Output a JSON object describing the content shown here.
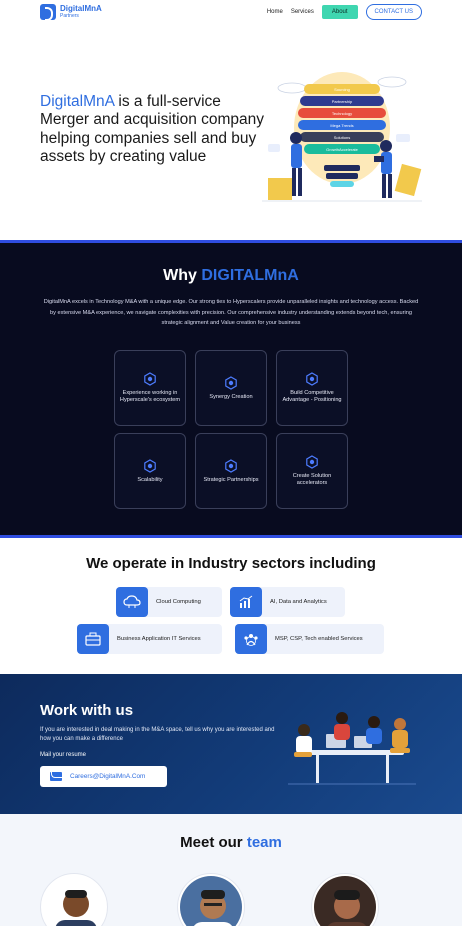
{
  "header": {
    "logo_name": "DigitalMnA",
    "logo_sub": "Partners",
    "nav": {
      "home": "Home",
      "services": "Services",
      "about": "About",
      "contact": "CONTACT US"
    }
  },
  "hero": {
    "brand": "DigitalMnA",
    "text": " is a full-service Merger and acquisition company helping companies sell and buy assets by creating value",
    "illustration_layers": [
      "Sourcing",
      "Partnership",
      "Technology",
      "Mega Trends",
      "Solutions",
      "GrowthAccelerate"
    ]
  },
  "why": {
    "title_prefix": "Why ",
    "title_accent": "DIGITALMnA",
    "description": "DigitalMnA excels in Technology M&A with a unique edge. Our strong ties to Hyperscalers provide unparalleled insights and technology access. Backed by extensive M&A experience, we navigate complexities with precision. Our comprehensive industry understanding extends beyond tech, ensuring strategic alignment and Value creation for your business",
    "cards": [
      {
        "label": "Experience working in Hyperscale's ecosystem",
        "icon": "hexagon-gear-icon"
      },
      {
        "label": "Synergy Creation",
        "icon": "hexagon-gear-icon"
      },
      {
        "label": "Build Competitive Advantage - Positioning",
        "icon": "hexagon-gear-icon"
      },
      {
        "label": "Scalability",
        "icon": "hexagon-gear-icon"
      },
      {
        "label": "Strategic Partnerships",
        "icon": "hexagon-gear-icon"
      },
      {
        "label": "Create Solution accelerators",
        "icon": "hexagon-gear-icon"
      }
    ]
  },
  "sectors": {
    "title": "We operate in Industry sectors including",
    "items": [
      {
        "label": "Cloud Computing",
        "icon": "cloud-icon"
      },
      {
        "label": "AI, Data and Analytics",
        "icon": "analytics-icon"
      },
      {
        "label": "Business Application IT Services",
        "icon": "briefcase-icon"
      },
      {
        "label": "MSP, CSP, Tech enabled Services",
        "icon": "team-icon"
      }
    ]
  },
  "work": {
    "title": "Work with us",
    "description": "If you are interested in deal making in the M&A space, tell us why you are interested and how you can make a difference",
    "mail_label": "Mail your resume",
    "email": "Careers@DigitalMnA.Com"
  },
  "team": {
    "title_prefix": "Meet our ",
    "title_accent": "team"
  },
  "colors": {
    "accent": "#2f6ee0",
    "about_button": "#3fd6b0",
    "dark_bg": "#080b1f",
    "work_bg": "#123b78"
  }
}
